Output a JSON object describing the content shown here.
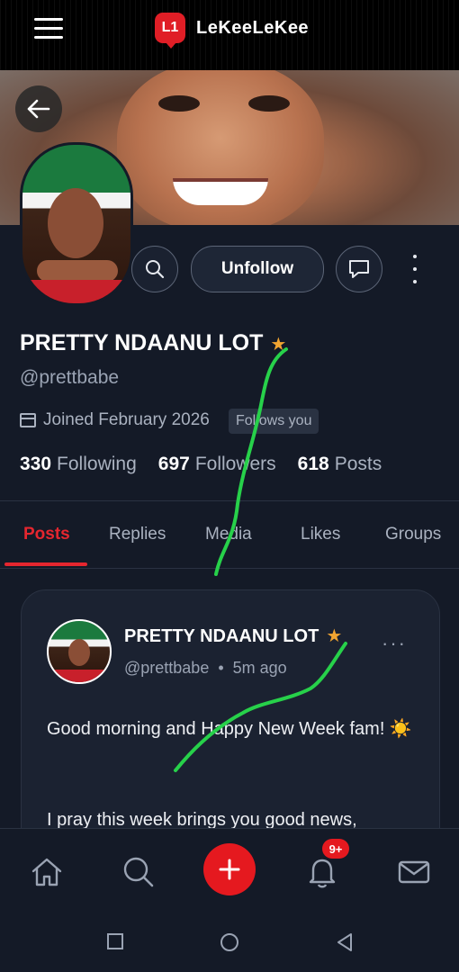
{
  "app": {
    "logo_badge": "L1",
    "logo_text": "LeKeeLeKee"
  },
  "profile": {
    "name": "PRETTY NDAANU LOT",
    "handle": "@prettbabe",
    "joined": "Joined February 2026",
    "follows_you": "Follows you",
    "stats": {
      "following_count": "330",
      "following_label": "Following",
      "followers_count": "697",
      "followers_label": "Followers",
      "posts_count": "618",
      "posts_label": "Posts"
    },
    "unfollow_label": "Unfollow"
  },
  "tabs": [
    "Posts",
    "Replies",
    "Media",
    "Likes",
    "Groups"
  ],
  "post": {
    "author": "PRETTY NDAANU LOT",
    "handle": "@prettbabe",
    "time": "5m ago",
    "text": "Good morning and Happy New Week fam! ☀️",
    "text_line2": "I pray this week brings you good news,"
  },
  "nav": {
    "notification_badge": "9+"
  },
  "colors": {
    "accent": "#e5262f",
    "star": "#f2a531",
    "background": "#141a27",
    "annotation": "#27d14a"
  }
}
